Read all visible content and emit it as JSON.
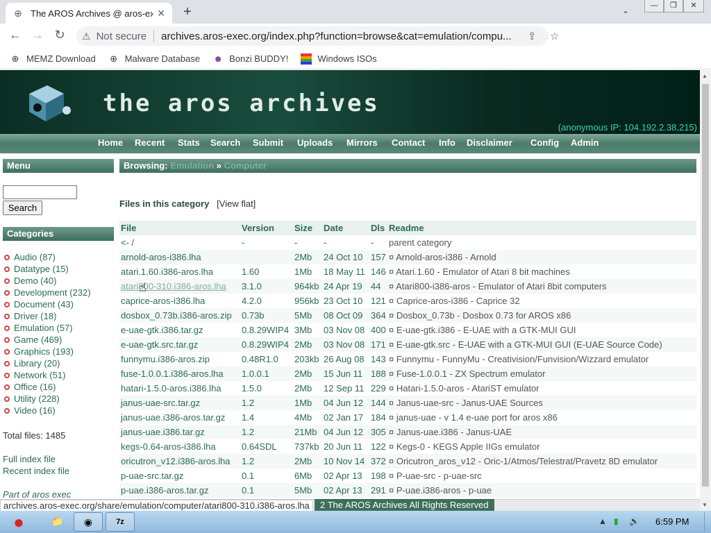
{
  "tab": {
    "title": "The AROS Archives @ aros-exec",
    "icon": "globe-icon"
  },
  "address": {
    "security": "Not secure",
    "url": "archives.aros-exec.org/index.php?function=browse&cat=emulation/compu..."
  },
  "bookmarks": [
    {
      "label": "MEMZ Download",
      "icon": "globe-icon"
    },
    {
      "label": "Malware Database",
      "icon": "globe-icon"
    },
    {
      "label": "Bonzi BUDDY!",
      "icon": "bonzi-icon"
    },
    {
      "label": "Windows ISOs",
      "icon": "windows-flag-icon"
    }
  ],
  "banner": {
    "logo": "the aros archives",
    "ip": "(anonymous IP: 104.192.2.38,215)"
  },
  "nav": [
    "Home",
    "Recent",
    "Stats",
    "Search",
    "Submit",
    "Uploads",
    "Mirrors",
    "Contact",
    "Info",
    "Disclaimer",
    "Config",
    "Admin"
  ],
  "sidebar": {
    "menu_title": "Menu",
    "search_button": "Search",
    "categories_title": "Categories",
    "categories": [
      "Audio (87)",
      "Datatype (15)",
      "Demo (40)",
      "Development (232)",
      "Document (43)",
      "Driver (18)",
      "Emulation (57)",
      "Game (469)",
      "Graphics (193)",
      "Library (20)",
      "Network (51)",
      "Office (16)",
      "Utility (228)",
      "Video (16)"
    ],
    "total": "Total files: 1485",
    "full_index": "Full index file",
    "recent_index": "Recent index file",
    "part_of": "Part of aros exec"
  },
  "browse": {
    "label": "Browsing:",
    "crumb1": "Emulation",
    "sep": "»",
    "crumb2": "Computer"
  },
  "files_heading": "Files in this category",
  "view_flat": "[View flat]",
  "table": {
    "headers": [
      "File",
      "Version",
      "Size",
      "Date",
      "Dls",
      "Readme"
    ],
    "rows": [
      [
        "<- /",
        "-",
        "-",
        "-",
        "-",
        "parent category"
      ],
      [
        "arnold-aros-i386.lha",
        "",
        "2Mb",
        "24 Oct 10",
        "157",
        "¤ Arnold-aros-i386 - Arnold"
      ],
      [
        "atari.1.60.i386-aros.lha",
        "1.60",
        "1Mb",
        "18 May 11",
        "146",
        "¤ Atari.1.60 - Emulator of Atari 8 bit machines"
      ],
      [
        "atari800-310.i386-aros.lha",
        "3.1.0",
        "964kb",
        "24 Apr 19",
        "44",
        "¤ Atari800-i386-aros - Emulator of Atari 8bit computers"
      ],
      [
        "caprice-aros-i386.lha",
        "4.2.0",
        "956kb",
        "23 Oct 10",
        "121",
        "¤ Caprice-aros-i386 - Caprice 32"
      ],
      [
        "dosbox_0.73b.i386-aros.zip",
        "0.73b",
        "5Mb",
        "08 Oct 09",
        "364",
        "¤ Dosbox_0.73b - Dosbox 0.73 for AROS x86"
      ],
      [
        "e-uae-gtk.i386.tar.gz",
        "0.8.29WIP4",
        "3Mb",
        "03 Nov 08",
        "400",
        "¤ E-uae-gtk.i386 - E-UAE with a GTK-MUI GUI"
      ],
      [
        "e-uae-gtk.src.tar.gz",
        "0.8.29WIP4",
        "2Mb",
        "03 Nov 08",
        "171",
        "¤ E-uae-gtk.src - E-UAE with a GTK-MUI GUI (E-UAE Source Code)"
      ],
      [
        "funnymu.i386-aros.zip",
        "0.48R1.0",
        "203kb",
        "26 Aug 08",
        "143",
        "¤ Funnymu - FunnyMu - Creativision/Funvision/Wizzard emulator"
      ],
      [
        "fuse-1.0.0.1.i386-aros.lha",
        "1.0.0.1",
        "2Mb",
        "15 Jun 11",
        "188",
        "¤ Fuse-1.0.0.1 - ZX Spectrum emulator"
      ],
      [
        "hatari-1.5.0-aros.i386.lha",
        "1.5.0",
        "2Mb",
        "12 Sep 11",
        "229",
        "¤ Hatari-1.5.0-aros - AtariST emulator"
      ],
      [
        "janus-uae-src.tar.gz",
        "1.2",
        "1Mb",
        "04 Jun 12",
        "144",
        "¤ Janus-uae-src - Janus-UAE Sources"
      ],
      [
        "janus-uae.i386-aros.tar.gz",
        "1.4",
        "4Mb",
        "02 Jan 17",
        "184",
        "¤ janus-uae - v 1.4 e-uae port for aros x86"
      ],
      [
        "janus-uae.i386.tar.gz",
        "1.2",
        "21Mb",
        "04 Jun 12",
        "305",
        "¤ Janus-uae.i386 - Janus-UAE"
      ],
      [
        "kegs-0.64-aros-i386.lha",
        "0.64SDL",
        "737kb",
        "20 Jun 11",
        "122",
        "¤ Kegs-0 - KEGS Apple IIGs emulator"
      ],
      [
        "oricutron_v12.i386-aros.lha",
        "1.2",
        "2Mb",
        "10 Nov 14",
        "372",
        "¤ Oricutron_aros_v12 - Oric-1/Atmos/Telestrat/Pravetz 8D emulator"
      ],
      [
        "p-uae-src.tar.gz",
        "0.1",
        "6Mb",
        "02 Apr 13",
        "198",
        "¤ P-uae-src - p-uae-src"
      ],
      [
        "p-uae.i386-aros.tar.gz",
        "0.1",
        "5Mb",
        "02 Apr 13",
        "291",
        "¤ P-uae.i386-aros - p-uae"
      ]
    ]
  },
  "status": {
    "link": "archives.aros-exec.org/share/emulation/computer/atari800-310.i386-aros.lha",
    "copyright": "2 The AROS Archives All Rights Reserved"
  },
  "taskbar": {
    "clock": "6:59 PM"
  }
}
